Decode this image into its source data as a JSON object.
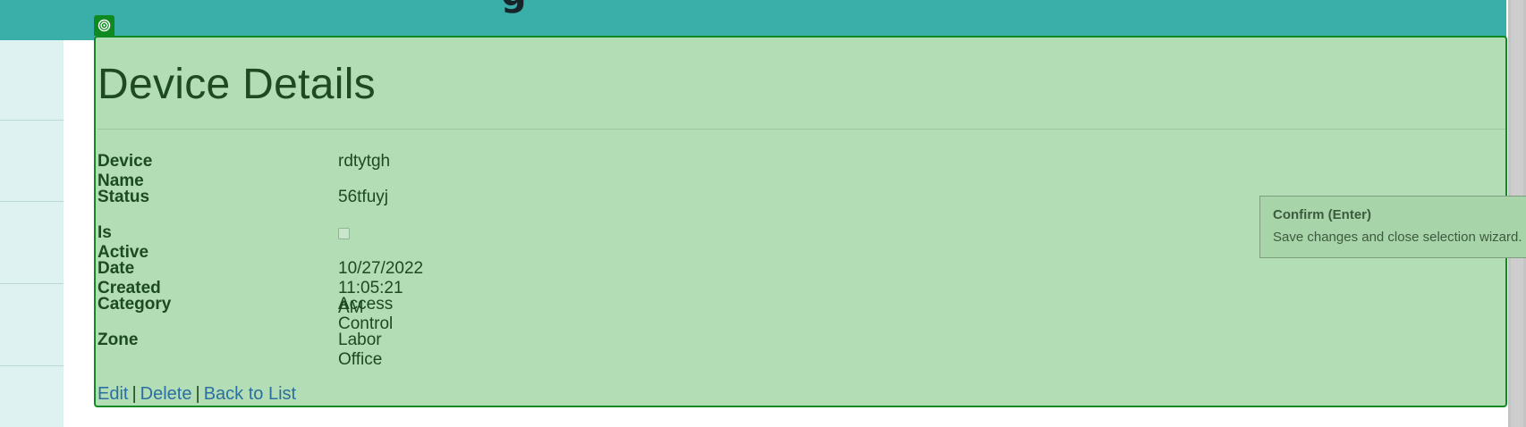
{
  "banner": {
    "title_fragment": "g"
  },
  "page": {
    "title": "Device Details"
  },
  "details": [
    {
      "label": "Device Name",
      "value": "rdtytgh"
    },
    {
      "label": "Status",
      "value": "56tfuyj"
    },
    {
      "label": "Is Active",
      "checked": false
    },
    {
      "label": "Date Created",
      "value": "10/27/2022 11:05:21 AM"
    },
    {
      "label": "Category",
      "value": "Access Control"
    },
    {
      "label": "Zone",
      "value": "Labor Office"
    }
  ],
  "actions": {
    "edit": "Edit",
    "delete": "Delete",
    "back": "Back to List",
    "separator": "|"
  },
  "tooltip": {
    "title": "Confirm (Enter)",
    "body": "Save changes and close selection wizard."
  },
  "colors": {
    "banner": "#3aafa9",
    "sidebar": "#def2f1",
    "selection_fill": "#b3ddb5",
    "selection_border": "#0f8a20",
    "link": "#2a6fa0"
  },
  "icons": {
    "selection_handle": "target-icon"
  }
}
